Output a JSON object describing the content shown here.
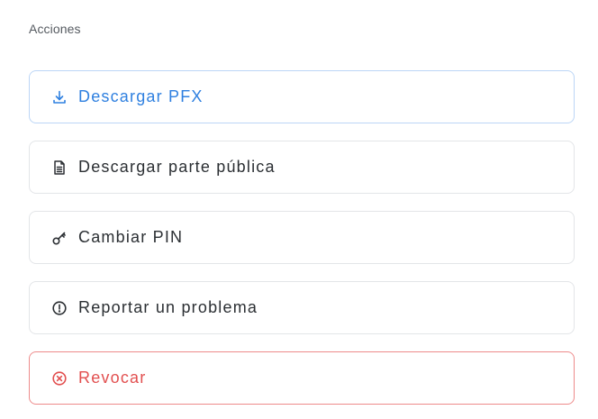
{
  "section": {
    "title": "Acciones"
  },
  "actions": [
    {
      "label": "Descargar PFX",
      "icon": "download-icon",
      "variant": "primary",
      "color": "#2f80e0"
    },
    {
      "label": "Descargar parte pública",
      "icon": "document-icon",
      "variant": "default",
      "color": "#2b2f33"
    },
    {
      "label": "Cambiar PIN",
      "icon": "key-icon",
      "variant": "default",
      "color": "#2b2f33"
    },
    {
      "label": "Reportar un problema",
      "icon": "alert-circle-icon",
      "variant": "default",
      "color": "#2b2f33"
    },
    {
      "label": "Revocar",
      "icon": "close-circle-icon",
      "variant": "danger",
      "color": "#e25050"
    }
  ]
}
